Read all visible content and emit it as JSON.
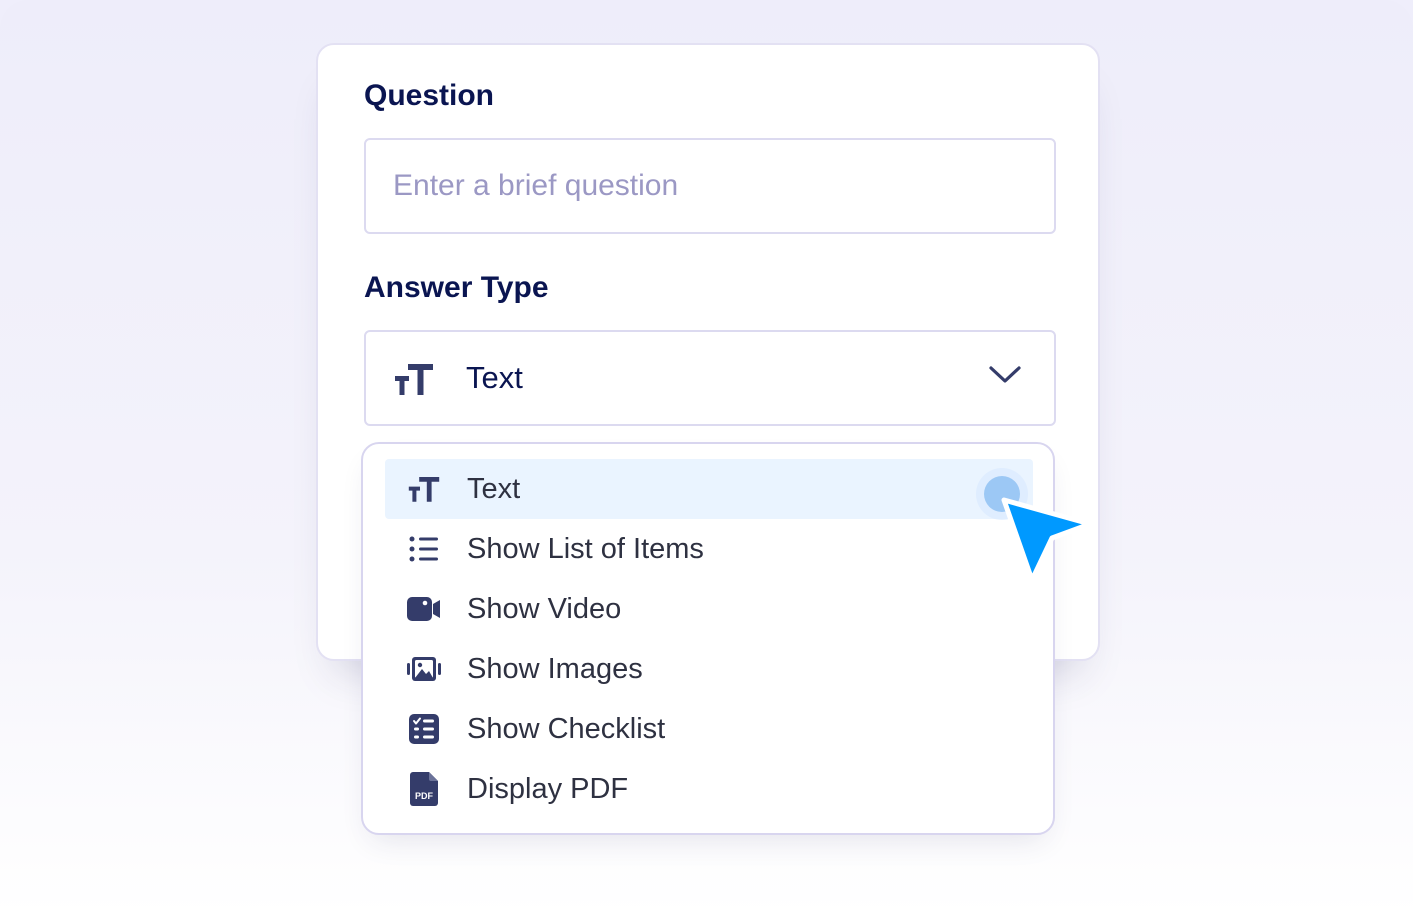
{
  "form": {
    "question_label": "Question",
    "question_placeholder": "Enter a brief question",
    "answer_type_label": "Answer Type",
    "selected_value": "Text"
  },
  "dropdown": {
    "options": [
      {
        "label": "Text",
        "icon": "text-size-icon",
        "selected": true
      },
      {
        "label": "Show List of Items",
        "icon": "list-icon",
        "selected": false
      },
      {
        "label": "Show Video",
        "icon": "video-camera-icon",
        "selected": false
      },
      {
        "label": "Show Images",
        "icon": "image-gallery-icon",
        "selected": false
      },
      {
        "label": "Show Checklist",
        "icon": "checklist-icon",
        "selected": false
      },
      {
        "label": "Display PDF",
        "icon": "pdf-file-icon",
        "selected": false,
        "icon_text": "PDF"
      }
    ]
  },
  "colors": {
    "heading": "#0a1551",
    "placeholder": "#9b98c4",
    "option_text": "#2e3141",
    "selected_bg": "#eaf4ff",
    "cursor": "#0099ff",
    "icon": "#343c6a"
  }
}
